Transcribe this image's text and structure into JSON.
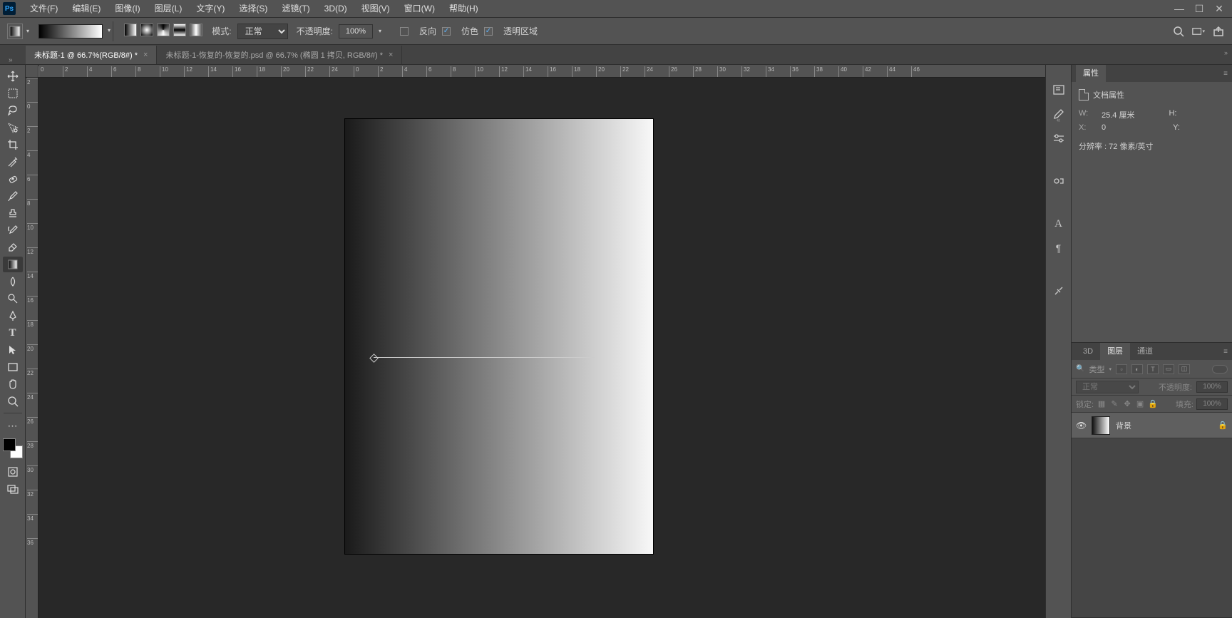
{
  "menubar": {
    "items": [
      "文件(F)",
      "编辑(E)",
      "图像(I)",
      "图层(L)",
      "文字(Y)",
      "选择(S)",
      "滤镜(T)",
      "3D(D)",
      "视图(V)",
      "窗口(W)",
      "帮助(H)"
    ]
  },
  "options": {
    "mode_label": "模式:",
    "mode_value": "正常",
    "opacity_label": "不透明度:",
    "opacity_value": "100%",
    "reverse_label": "反向",
    "dither_label": "仿色",
    "transparency_label": "透明区域"
  },
  "tabs": {
    "active": "未标题-1 @ 66.7%(RGB/8#) *",
    "inactive": "未标题-1-恢复的-恢复的.psd @ 66.7% (椭圆 1 拷贝, RGB/8#) *"
  },
  "ruler_h": [
    "0",
    "2",
    "4",
    "6",
    "8",
    "10",
    "12",
    "14",
    "16",
    "18",
    "20",
    "22",
    "24",
    "0",
    "2",
    "4",
    "6",
    "8",
    "10",
    "12",
    "14",
    "16",
    "18",
    "20",
    "22",
    "24",
    "26",
    "28",
    "30",
    "32",
    "34",
    "36",
    "38",
    "40",
    "42",
    "44",
    "46"
  ],
  "ruler_v": [
    "2",
    "0",
    "2",
    "4",
    "6",
    "8",
    "10",
    "12",
    "14",
    "16",
    "18",
    "20",
    "22",
    "24",
    "26",
    "28",
    "30",
    "32",
    "34",
    "36"
  ],
  "properties": {
    "panel_title": "属性",
    "doc_properties": "文档属性",
    "w_label": "W:",
    "w_value": "25.4 厘米",
    "h_label": "H:",
    "h_value": "",
    "x_label": "X:",
    "x_value": "0",
    "y_label": "Y:",
    "y_value": "",
    "resolution": "分辨率 : 72 像素/英寸"
  },
  "layers": {
    "tab_3d": "3D",
    "tab_layers": "图层",
    "tab_channels": "通道",
    "search_placeholder": "类型",
    "blend_mode": "正常",
    "opacity_label": "不透明度:",
    "opacity_value": "100%",
    "lock_label": "锁定:",
    "fill_label": "填充:",
    "fill_value": "100%",
    "bg_layer": "背景"
  }
}
